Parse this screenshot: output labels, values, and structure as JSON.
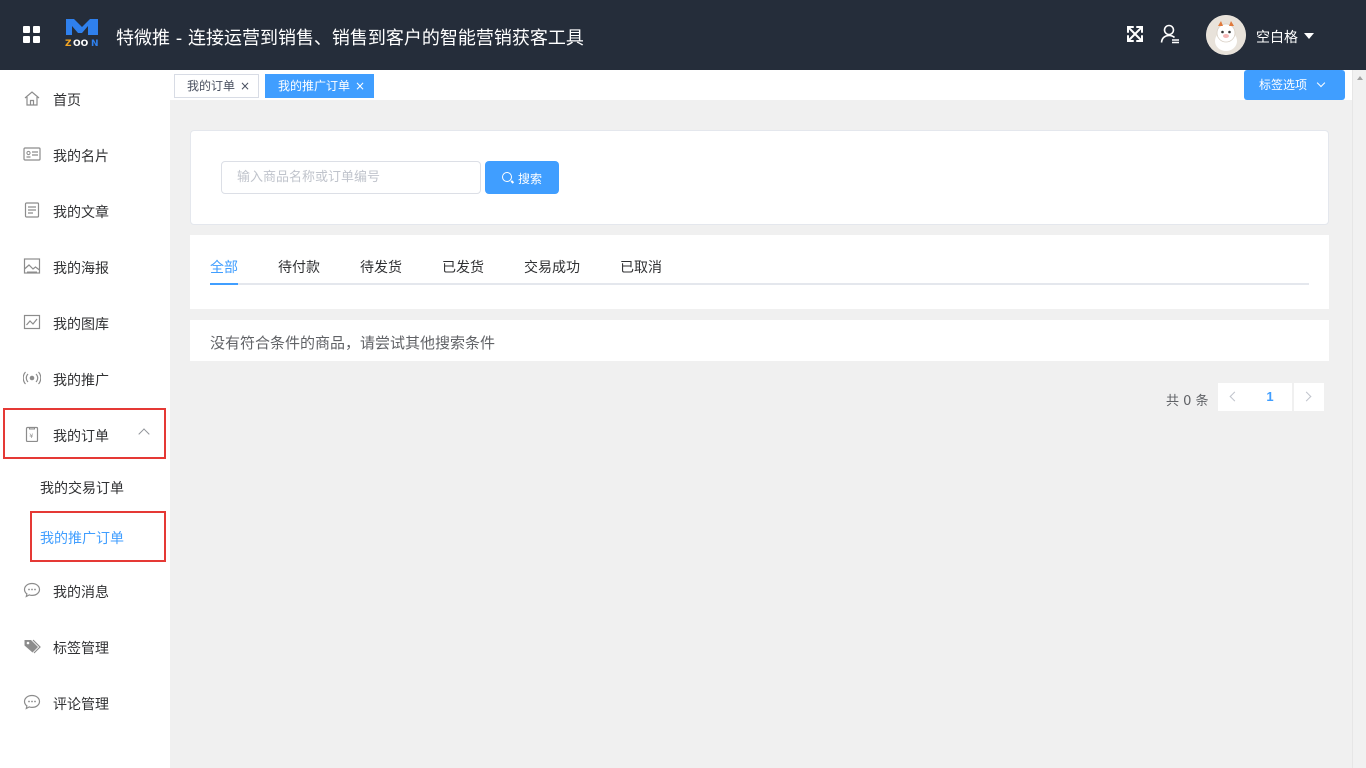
{
  "header": {
    "title": "特微推 - 连接运营到销售、销售到客户的智能营销获客工具",
    "logo_text": "ZOON",
    "user_name": "空白格"
  },
  "sidebar": {
    "items": [
      {
        "label": "首页",
        "icon": "home-icon"
      },
      {
        "label": "我的名片",
        "icon": "id-card-icon"
      },
      {
        "label": "我的文章",
        "icon": "document-icon"
      },
      {
        "label": "我的海报",
        "icon": "poster-icon"
      },
      {
        "label": "我的图库",
        "icon": "gallery-icon"
      },
      {
        "label": "我的推广",
        "icon": "broadcast-icon"
      },
      {
        "label": "我的订单",
        "icon": "order-icon"
      },
      {
        "label": "我的消息",
        "icon": "chat-icon"
      },
      {
        "label": "标签管理",
        "icon": "tag-icon"
      },
      {
        "label": "评论管理",
        "icon": "comment-icon"
      }
    ],
    "sub_items": [
      {
        "label": "我的交易订单"
      },
      {
        "label": "我的推广订单",
        "active": true
      }
    ]
  },
  "tabbar": {
    "tags": [
      {
        "label": "我的订单",
        "close": "×"
      },
      {
        "label": "我的推广订单",
        "close": "×",
        "active": true
      }
    ],
    "options_label": "标签选项"
  },
  "search": {
    "placeholder": "输入商品名称或订单编号",
    "value": "",
    "button_label": "搜索"
  },
  "order_tabs": [
    "全部",
    "待付款",
    "待发货",
    "已发货",
    "交易成功",
    "已取消"
  ],
  "empty_message": "没有符合条件的商品，请尝试其他搜索条件",
  "pagination": {
    "total_text": "共 0 条",
    "current_page": "1"
  },
  "colors": {
    "header_bg": "#252d3a",
    "accent": "#409eff",
    "highlight_box": "#e53935"
  }
}
